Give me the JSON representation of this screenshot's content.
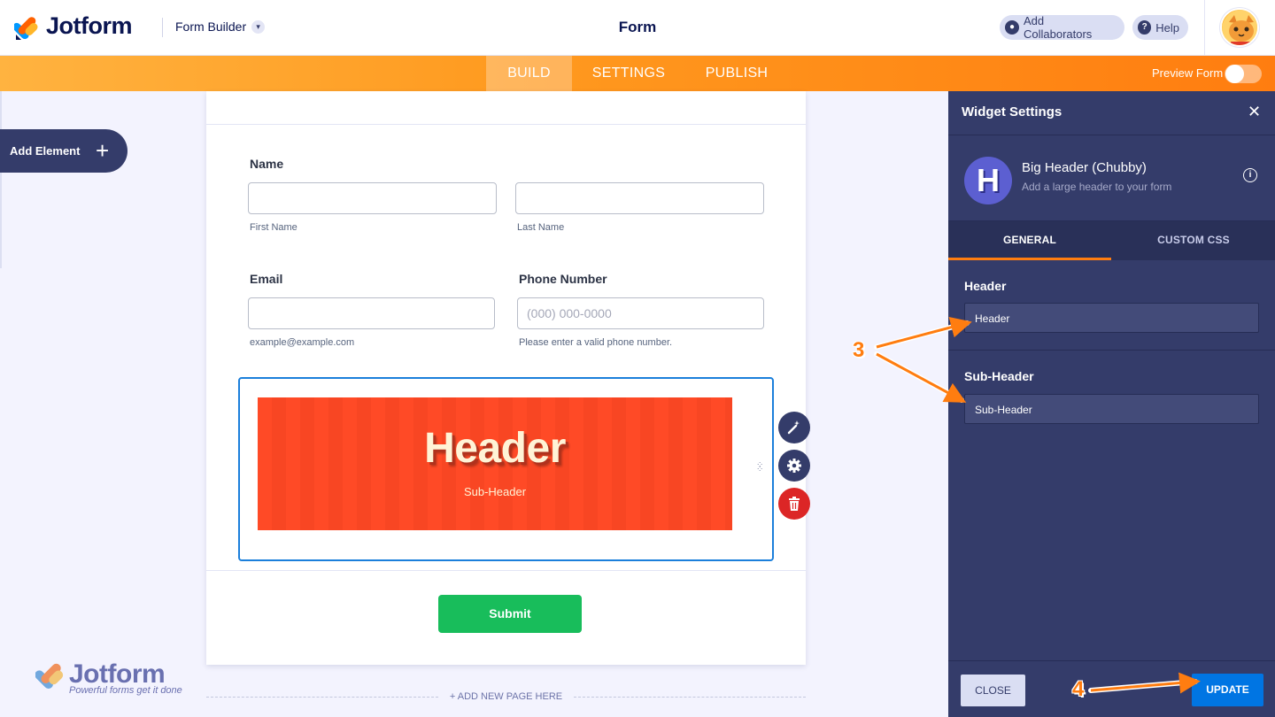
{
  "topbar": {
    "brand": "Jotform",
    "builder_label": "Form Builder",
    "form_title": "Form",
    "collaborators_label": "Add Collaborators",
    "help_label": "Help"
  },
  "nav": {
    "tabs": [
      "BUILD",
      "SETTINGS",
      "PUBLISH"
    ],
    "active_tab": "BUILD",
    "preview_label": "Preview Form",
    "preview_on": false
  },
  "left": {
    "add_element_label": "Add Element"
  },
  "form": {
    "name_label": "Name",
    "first_name_sub": "First Name",
    "last_name_sub": "Last Name",
    "email_label": "Email",
    "email_sub": "example@example.com",
    "phone_label": "Phone Number",
    "phone_placeholder": "(000) 000-0000",
    "phone_sub": "Please enter a valid phone number.",
    "widget_header": "Header",
    "widget_subheader": "Sub-Header",
    "submit_label": "Submit",
    "add_page_label": "+ ADD NEW PAGE HERE",
    "watermark_brand": "Jotform",
    "watermark_tagline": "Powerful forms get it done"
  },
  "panel": {
    "title": "Widget Settings",
    "widget_name": "Big Header (Chubby)",
    "widget_desc": "Add a large header to your form",
    "tabs": [
      "GENERAL",
      "CUSTOM CSS"
    ],
    "active_tab": "GENERAL",
    "header_label": "Header",
    "header_value": "Header",
    "subheader_label": "Sub-Header",
    "subheader_value": "Sub-Header",
    "close_label": "CLOSE",
    "update_label": "UPDATE"
  },
  "annotations": {
    "step_3": "3",
    "step_4": "4"
  },
  "colors": {
    "nav_orange": "#ff7d10",
    "panel_bg": "#343c6a",
    "banner_red": "#ff4a26",
    "submit_green": "#18bd5b",
    "update_blue": "#0075e3",
    "selection_blue": "#1b7fdb"
  }
}
